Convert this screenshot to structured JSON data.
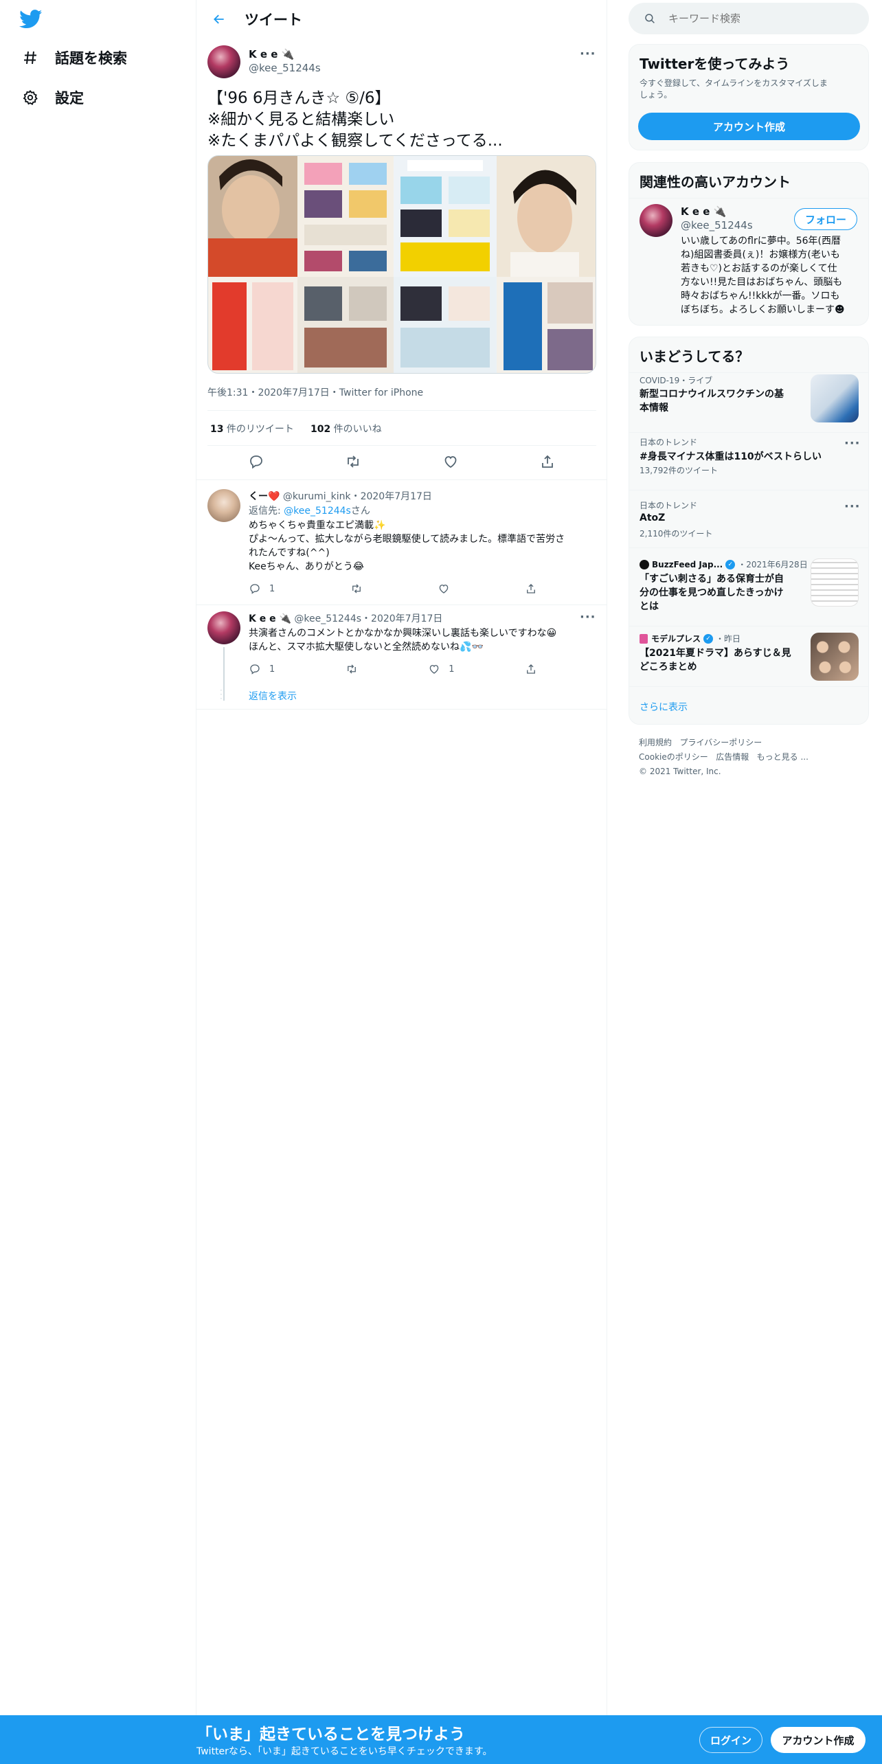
{
  "sidebar": {
    "items": [
      {
        "label": "話題を検索",
        "icon": "hashtag-icon"
      },
      {
        "label": "設定",
        "icon": "gear-icon"
      }
    ]
  },
  "header": {
    "title": "ツイート"
  },
  "tweet": {
    "display_name": "K e e 🔌",
    "handle": "@kee_51244s",
    "text_lines": [
      "【'96 6月きんき☆ ⑤/6】",
      "※細かく見ると結構楽しい",
      "※たくまパパよく観察してくださってる..."
    ],
    "meta": "午後1:31・2020年7月17日・Twitter for iPhone",
    "retweets": "13",
    "retweets_label": " 件のリツイート",
    "likes": "102",
    "likes_label": " 件のいいね"
  },
  "replies": [
    {
      "display_name": "くー❤️",
      "handle": "@kurumi_kink",
      "date": "・2020年7月17日",
      "reply_to_prefix": "返信先: ",
      "reply_to_handle": "@kee_51244s",
      "reply_to_suffix": "さん",
      "text_lines": [
        "めちゃくちゃ貴重なエピ満載✨",
        "ぴよ〜んって、拡大しながら老眼鏡駆使して読みました。標準語で苦労さ",
        "れたんですね(^^)",
        "Keeちゃん、ありがとう😂"
      ],
      "reply_count": "1",
      "like_count": ""
    },
    {
      "display_name": "K e e 🔌",
      "handle": "@kee_51244s",
      "date": "・2020年7月17日",
      "text_lines": [
        "共演者さんのコメントとかなかなか興味深いし裏話も楽しいですわな😀",
        "ほんと、スマホ拡大駆使しないと全然読めないね💦👓"
      ],
      "reply_count": "1",
      "like_count": "1"
    }
  ],
  "show_replies": "返信を表示",
  "search": {
    "placeholder": "キーワード検索"
  },
  "signup": {
    "title": "Twitterを使ってみよう",
    "desc_lines": [
      "今すぐ登録して、タイムラインをカスタマイズしま",
      "しょう。"
    ],
    "button": "アカウント作成"
  },
  "related": {
    "title": "関連性の高いアカウント",
    "display_name": "K e e 🔌",
    "handle": "@kee_51244s",
    "follow": "フォロー",
    "bio_lines": [
      "いい歳してあのflrに夢中。56年(西暦",
      "ね)組図書委員(ぇ)！お嬢様方(老いも",
      "若きも♡)とお話するのが楽しくて仕",
      "方ない!!見た目はおばちゃん、頭脳も",
      "時々おばちゃん!!kkkが一番。ソロも",
      "ぼちぼち。よろしくお願いしまーす☻"
    ]
  },
  "trends": {
    "title": "いまどうしてる？",
    "items": [
      {
        "context": "COVID-19・ライブ",
        "title_lines": [
          "新型コロナウイルスワクチンの基",
          "本情報"
        ]
      },
      {
        "context": "日本のトレンド",
        "title_lines": [
          "#身長マイナス体重は110がベストらしい"
        ],
        "count": "13,792件のツイート"
      },
      {
        "context": "日本のトレンド",
        "title_lines": [
          "AtoZ"
        ],
        "count": "2,110件のツイート"
      },
      {
        "source": "BuzzFeed Jap...",
        "date": "・2021年6月28日",
        "title_lines": [
          "「すごい刺さる」ある保育士が自",
          "分の仕事を見つめ直したきっかけ",
          "とは"
        ]
      },
      {
        "source": "モデルプレス",
        "date": "・昨日",
        "title_lines": [
          "【2021年夏ドラマ】あらすじ＆見",
          "どころまとめ"
        ]
      }
    ],
    "show_more": "さらに表示"
  },
  "footer": {
    "line1": [
      "利用規約",
      "プライバシーポリシー"
    ],
    "line2": [
      "Cookieのポリシー",
      "広告情報",
      "もっと見る ..."
    ],
    "copyright": "© 2021 Twitter, Inc."
  },
  "banner": {
    "title": "「いま」起きていることを見つけよう",
    "subtitle": "Twitterなら、「いま」起きていることをいち早くチェックできます。",
    "login": "ログイン",
    "signup": "アカウント作成"
  },
  "colors": {
    "accent": "#1d9bf0",
    "text": "#0f1419",
    "muted": "#536471"
  }
}
